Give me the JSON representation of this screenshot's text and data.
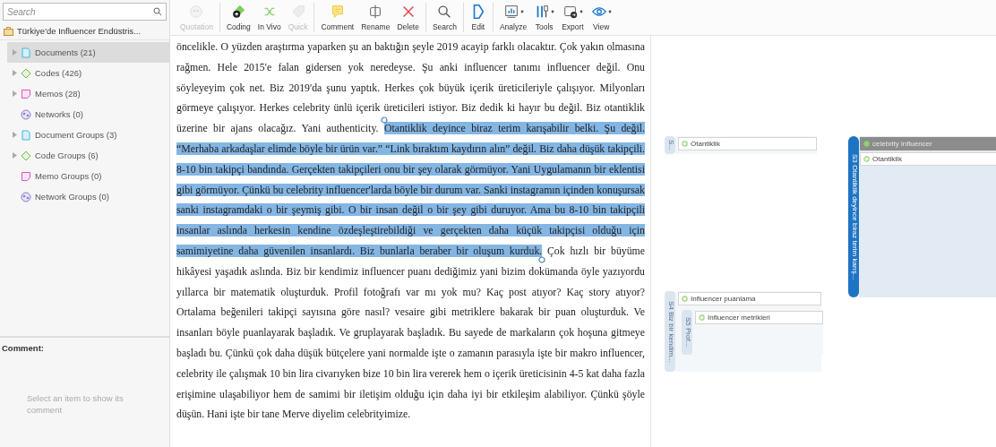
{
  "sidebar": {
    "search": {
      "placeholder": "Search"
    },
    "project_title": "Türkiye'de Influencer Endüstris...",
    "items": [
      {
        "label": "Documents (21)",
        "kind": "document",
        "expandable": true,
        "selected": true
      },
      {
        "label": "Codes (426)",
        "kind": "code",
        "expandable": true,
        "selected": false
      },
      {
        "label": "Memos (28)",
        "kind": "memo",
        "expandable": true,
        "selected": false
      },
      {
        "label": "Networks (0)",
        "kind": "network",
        "expandable": false,
        "selected": false
      },
      {
        "label": "Document Groups (3)",
        "kind": "document",
        "expandable": true,
        "selected": false
      },
      {
        "label": "Code Groups (6)",
        "kind": "code",
        "expandable": true,
        "selected": false
      },
      {
        "label": "Memo Groups (0)",
        "kind": "memo",
        "expandable": false,
        "selected": false
      },
      {
        "label": "Network Groups (0)",
        "kind": "network",
        "expandable": false,
        "selected": false
      }
    ],
    "comment": {
      "heading": "Comment:",
      "hint": "Select an item to show its comment"
    }
  },
  "toolbar": {
    "groups": [
      [
        {
          "label": "Quotation",
          "kind": "quotation",
          "disabled": true,
          "dropdown": false
        }
      ],
      [
        {
          "label": "Coding",
          "kind": "coding",
          "disabled": false,
          "dropdown": false
        },
        {
          "label": "In Vivo",
          "kind": "invivo",
          "disabled": false,
          "dropdown": false
        },
        {
          "label": "Quick",
          "kind": "quick",
          "disabled": true,
          "dropdown": false
        }
      ],
      [
        {
          "label": "Comment",
          "kind": "comment",
          "disabled": false,
          "dropdown": false
        },
        {
          "label": "Rename",
          "kind": "rename",
          "disabled": false,
          "dropdown": false
        },
        {
          "label": "Delete",
          "kind": "delete",
          "disabled": false,
          "dropdown": false
        }
      ],
      [
        {
          "label": "Search",
          "kind": "search",
          "disabled": false,
          "dropdown": false
        }
      ],
      [
        {
          "label": "Edit",
          "kind": "edit",
          "disabled": false,
          "dropdown": false
        }
      ],
      [
        {
          "label": "Analyze",
          "kind": "analyze",
          "disabled": false,
          "dropdown": true
        },
        {
          "label": "Tools",
          "kind": "tools",
          "disabled": false,
          "dropdown": true
        },
        {
          "label": "Export",
          "kind": "export",
          "disabled": false,
          "dropdown": true
        },
        {
          "label": "View",
          "kind": "view",
          "disabled": false,
          "dropdown": true
        }
      ]
    ]
  },
  "document": {
    "segments": [
      {
        "text": "öncelikle. O yüzden araştırma yaparken şu an baktığın şeyle 2019 acayip farklı olacaktır. Çok yakın olmasına rağmen. Hele 2015'e falan gidersen yok neredeyse. Şu anki influencer tanımı influencer değil. Onu söyleyeyim çok net. Biz 2019'da şunu yaptık. Herkes çok büyük içerik üreticileriyle çalışıyor. Milyonları görmeye çalışıyor. Herkes celebrity ünlü içerik üreticileri istiyor. Biz dedik ki hayır bu değil. Biz otantiklik üzerine bir ajans olacağız. Yani authenticity. ",
        "selected": false
      },
      {
        "text": "Otantiklik deyince biraz terim karışabilir belki. Şu değil. “Merhaba arkadaşlar elimde böyle bir ürün var.” “Link bıraktım kaydırın alın” değil. Biz daha düşük takipçili. 8-10 bin takipçi bandında. Gerçekten takipçileri onu bir şey olarak görmüyor. Yani Uygulamanın bir eklentisi gibi görmüyor. Çünkü bu celebrity influencer'larda böyle bir durum var. Sanki instagramın içinden konuşursak sanki instagramdaki o bir şeymiş gibi. O bir insan değil o bir şey gibi duruyor. Ama bu 8-10 bin takipçili insanlar aslında herkesin kendine özdeşleştirebildiği ve gerçekten daha küçük takipçisi olduğu için samimiyetine daha güvenilen insanlardı. Biz bunlarla beraber bir oluşum kurduk.",
        "selected": true
      },
      {
        "text": " Çok hızlı bir büyüme hikâyesi yaşadık aslında. Biz bir kendimiz influencer puanı dediğimiz yani bizim dokümanda öyle yazıyordu yıllarca bir matematik oluşturduk. Profil fotoğrafı var mı yok mu? Kaç post atıyor? Kaç story atıyor? Ortalama beğenileri takipçi sayısına göre nasıl? vesaire gibi metriklere bakarak bir puan oluşturduk. Ve insanları böyle puanlayarak başladık. Ve gruplayarak başladık. Bu sayede de markaların çok hoşuna gitmeye başladı bu. Çünkü çok daha düşük bütçelere yani normalde işte o zamanın parasıyla işte bir makro influencer, celebrity ile çalışmak 10 bin lira civarıyken bize 10 bin lira vererek hem o içerik üreticisinin 4-5 kat daha fazla erişimine ulaşabiliyor hem de samimi bir iletişim olduğu için daha iyi bir etkileşim alabiliyor. Çünkü şöyle düşün. Hani işte bir tane Merve diyelim celebrityimize.",
        "selected": false
      }
    ]
  },
  "margin": {
    "segments": [
      {
        "label": "S...",
        "kind": "normal",
        "codes": [
          {
            "name": "Otantiklik",
            "selected": false
          }
        ]
      },
      {
        "label": "S3 Otantiklik deyince biraz terim karış...",
        "kind": "active",
        "codes": [
          {
            "name": "celebrity influencer",
            "selected": true
          },
          {
            "name": "Otantiklik",
            "selected": false
          }
        ]
      },
      {
        "label": "S4 Biz bir kendim...",
        "kind": "normal",
        "codes": [
          {
            "name": "Influencer puanlama",
            "selected": false
          }
        ]
      },
      {
        "label": "S5 Prof...",
        "kind": "normal",
        "codes": [
          {
            "name": "Influencer metrikleri",
            "selected": false
          }
        ]
      }
    ]
  }
}
